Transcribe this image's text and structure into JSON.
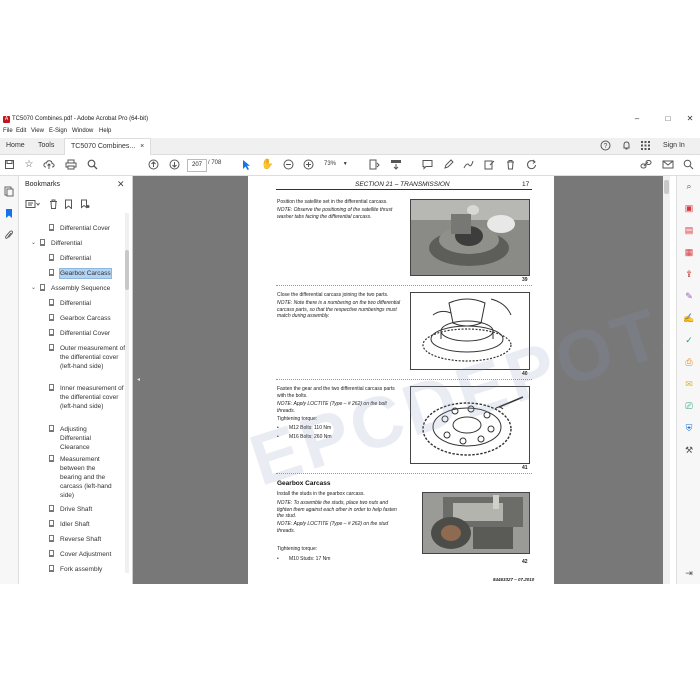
{
  "window": {
    "title": "TC5070 Combines.pdf - Adobe Acrobat Pro (64-bit)",
    "controls": [
      "–",
      "□",
      "✕"
    ]
  },
  "menu": [
    "File",
    "Edit",
    "View",
    "E-Sign",
    "Window",
    "Help"
  ],
  "tabs": {
    "home": "Home",
    "tools": "Tools",
    "doc": "TC5070 Combines...",
    "doc_close": "×",
    "sign_in": "Sign In"
  },
  "toolbar": {
    "page_current": "207",
    "page_total": "/ 708",
    "zoom": "73%"
  },
  "bookmarks": {
    "header": "Bookmarks",
    "close": "✕",
    "items": [
      {
        "label": "Differential Cover",
        "level": 2,
        "twisty": ""
      },
      {
        "label": "Differential",
        "level": 1,
        "twisty": "⌄"
      },
      {
        "label": "Differential",
        "level": 2,
        "twisty": ""
      },
      {
        "label": "Gearbox Carcass",
        "level": 2,
        "twisty": "",
        "selected": true
      },
      {
        "label": "Assembly Sequence",
        "level": 1,
        "twisty": "⌄"
      },
      {
        "label": "Differential",
        "level": 2,
        "twisty": ""
      },
      {
        "label": "Gearbox Carcass",
        "level": 2,
        "twisty": ""
      },
      {
        "label": "Differential Cover",
        "level": 2,
        "twisty": ""
      },
      {
        "label": "Outer measurement of the differential cover (left-hand side)",
        "level": 2,
        "twisty": ""
      },
      {
        "label": "Inner measurement of the differential cover (left-hand side)",
        "level": 2,
        "twisty": ""
      },
      {
        "label": "Adjusting Differential Clearance",
        "level": 2,
        "twisty": ""
      },
      {
        "label": "Measurement between the bearing and the carcass (left-hand side)",
        "level": 2,
        "twisty": ""
      },
      {
        "label": "Drive Shaft",
        "level": 2,
        "twisty": ""
      },
      {
        "label": "Idler Shaft",
        "level": 2,
        "twisty": ""
      },
      {
        "label": "Reverse Shaft",
        "level": 2,
        "twisty": ""
      },
      {
        "label": "Cover Adjustment",
        "level": 2,
        "twisty": ""
      },
      {
        "label": "Fork assembly",
        "level": 2,
        "twisty": ""
      }
    ]
  },
  "page": {
    "header_section": "SECTION 21 – TRANSMISSION",
    "header_page": "17",
    "blocks": [
      {
        "text": "Position the satellite set in the differential carcass.",
        "note": "NOTE: Observe the positioning of the satellite thrust washer tabs facing the differential carcass.",
        "fig": "39"
      },
      {
        "text": "Close the differential carcass joining the two parts.",
        "note": "NOTE: Note there is a numbering on the two differential carcass parts, so that the respective numberings must match during assembly.",
        "fig": "40"
      },
      {
        "text": "Fasten the gear and the two differential carcass parts with the bolts.",
        "note": "NOTE: Apply LOCTITE (Type – # 262) on the bolt threads.",
        "torque_label": "Tightening torque:",
        "torques": [
          "M12 Bolts: 110 Nm",
          "M16 Bolts: 260 Nm"
        ],
        "fig": "41"
      },
      {
        "heading": "Gearbox Carcass",
        "text": "Install the studs in the gearbox carcass.",
        "note": "NOTE: To assemble the studs, place two nuts and tighten them against each other in order to help fasten the stud.",
        "note2": "NOTE: Apply LOCTITE (Type – # 262) on the stud threads.",
        "torque_label": "Tightening torque:",
        "torques": [
          "M10 Studs: 17 Nm"
        ],
        "fig": "42"
      }
    ],
    "footer": "84463327 – 07.2010",
    "watermark": "EPCDEPOT.COM"
  },
  "colors": {
    "accent_red": "#c4151c",
    "selection": "#b3d3f2",
    "doc_bg": "#787878",
    "cursor_blue": "#1473e6"
  }
}
